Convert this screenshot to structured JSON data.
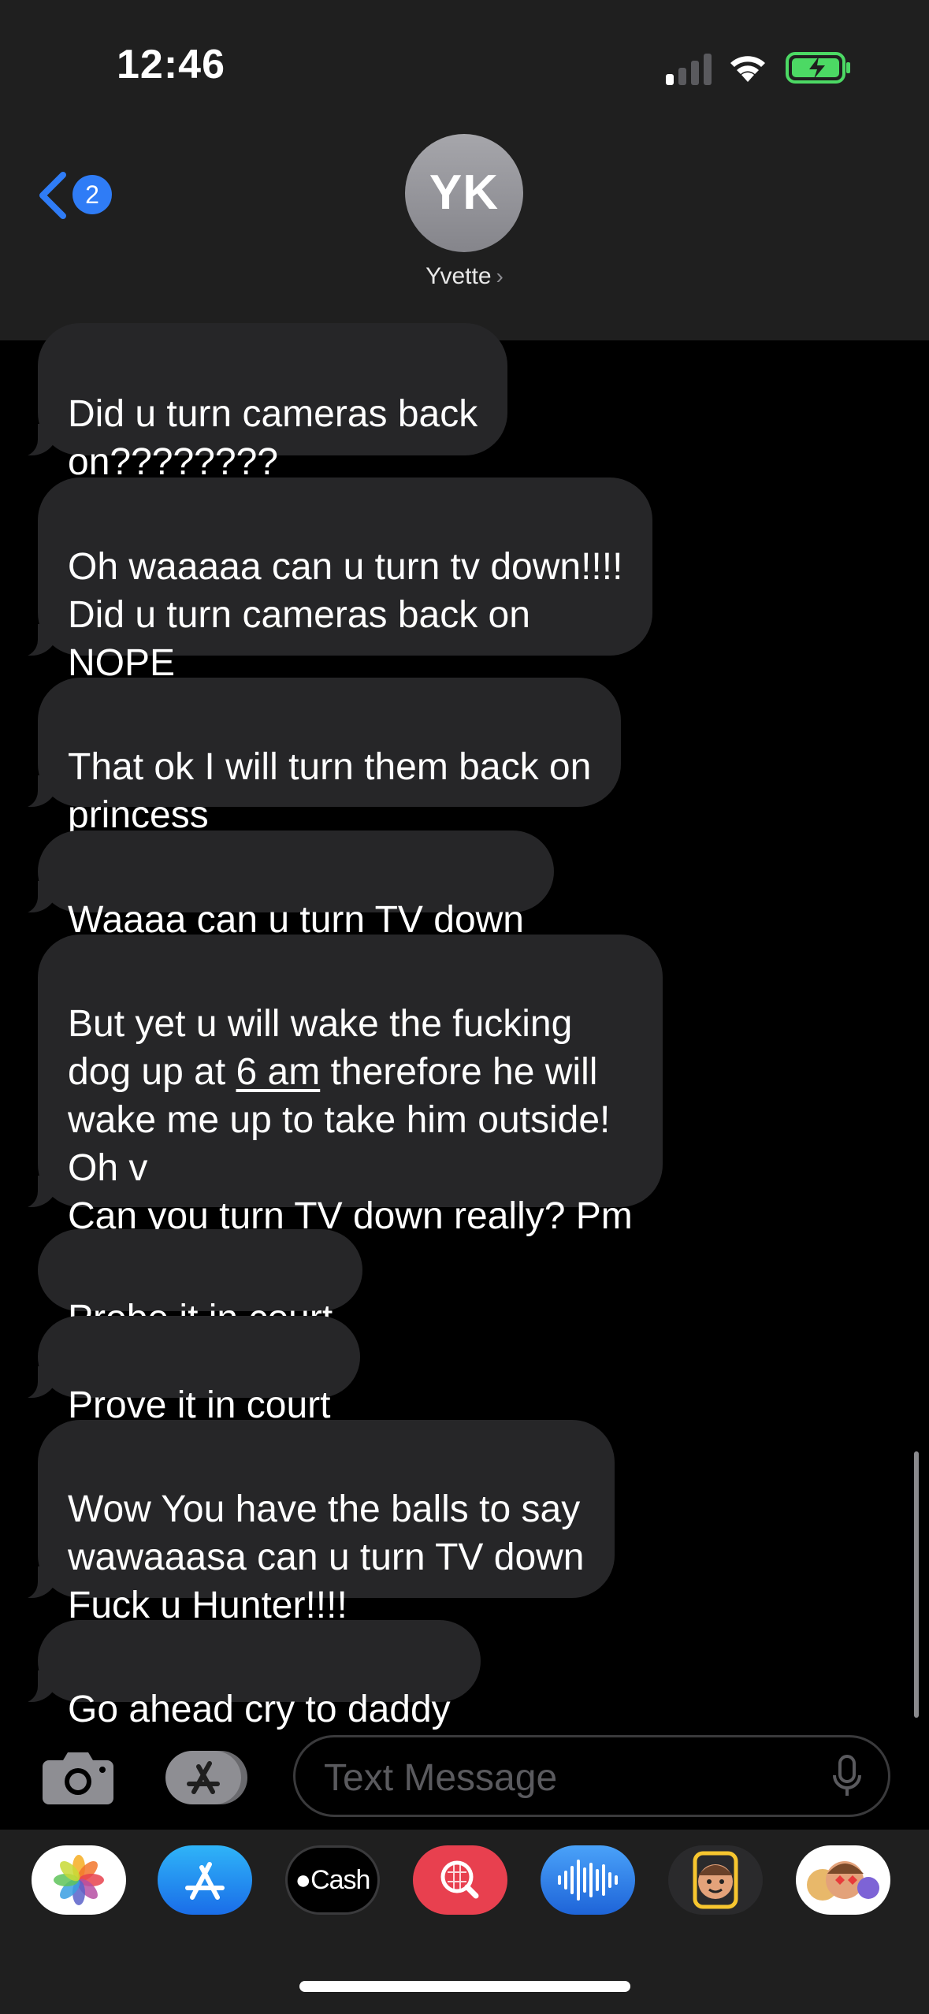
{
  "status_bar": {
    "time": "12:46"
  },
  "nav": {
    "back_badge": "2",
    "avatar_initials": "YK",
    "contact_name": "Yvette",
    "contact_chevron": "›"
  },
  "messages": [
    {
      "text": "Did u turn cameras back\non????????"
    },
    {
      "text": "Oh waaaaa can u turn tv down!!!!\nDid u turn cameras  back on\nNOPE"
    },
    {
      "text": "That ok I will turn them back on\nprincess"
    },
    {
      "text": "Waaaa can u turn TV down"
    },
    {
      "pre": "But yet u will wake the fucking\ndog up at ",
      "link": "6 am",
      "post": " therefore he will\nwake me up to take him outside!\nOh v\nCan you turn TV down really? Pm"
    },
    {
      "text": "Probe it in court"
    },
    {
      "text": "Prove it in court"
    },
    {
      "text": "Wow You have the balls to say\nwawaaasa can u turn TV down\nFuck u Hunter!!!!"
    },
    {
      "text": "Go ahead cry to daddy"
    }
  ],
  "composer": {
    "placeholder": "Text Message"
  },
  "app_drawer": {
    "apps": [
      {
        "icon": "photos-icon"
      },
      {
        "icon": "app-store-icon"
      },
      {
        "icon": "apple-cash-icon",
        "label": "Cash"
      },
      {
        "icon": "image-search-icon"
      },
      {
        "icon": "audio-message-icon"
      },
      {
        "icon": "memoji-icon"
      },
      {
        "icon": "memoji-stickers-icon"
      }
    ]
  },
  "colors": {
    "bubble": "#262628",
    "accent": "#2f7cf6",
    "battery": "#4cd964",
    "header": "#1f1f1f"
  }
}
